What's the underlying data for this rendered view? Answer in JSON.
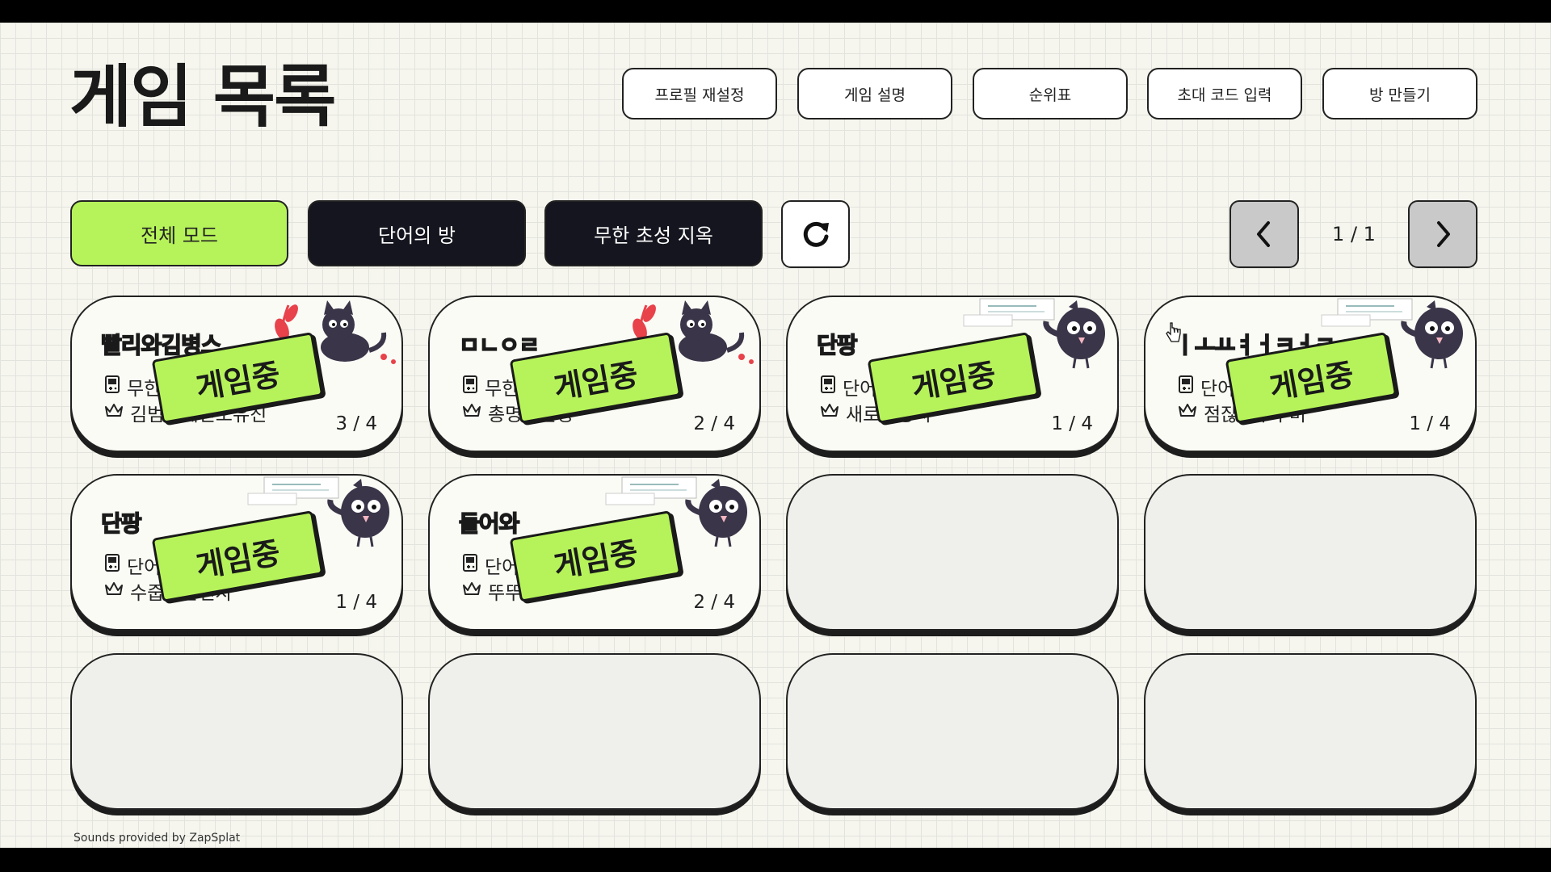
{
  "header": {
    "title": "게임 목록",
    "buttons": {
      "reset_profile": "프로필 재설정",
      "game_guide": "게임 설명",
      "leaderboard": "순위표",
      "invite_code": "초대 코드 입력",
      "create_room": "방 만들기"
    }
  },
  "filters": {
    "all_modes": "전체 모드",
    "word_room": "단어의 방",
    "infinite_chosung": "무한 초성 지옥"
  },
  "pagination": {
    "text": "1 / 1"
  },
  "badge_label": "게임중",
  "rooms": [
    {
      "title": "빨리와김병스",
      "title_color": "#e8424a",
      "mode": "무한",
      "host": "김범수헤딘오유진",
      "players": "3 / 4",
      "mascot": "cat"
    },
    {
      "title": "ㅁㄴㅇㄹ",
      "title_color": "#e8424a",
      "mode": "무한",
      "host": "총명한권정",
      "players": "2 / 4",
      "mascot": "cat"
    },
    {
      "title": "단팡",
      "title_color": "#8fb4d4",
      "mode": "단어",
      "host": "새로운송지",
      "players": "1 / 4",
      "mascot": "bird"
    },
    {
      "title": "ㅣㅗㅛㅕㅓㅋㅓㅋ",
      "title_color": "#8fb4d4",
      "mode": "단어",
      "host": "점잖은부우미",
      "players": "1 / 4",
      "mascot": "bird"
    },
    {
      "title": "단팡",
      "title_color": "#8fb4d4",
      "mode": "단어",
      "host": "수줍은준선자",
      "players": "1 / 4",
      "mascot": "bird"
    },
    {
      "title": "들어와",
      "title_color": "#8fb4d4",
      "mode": "단어",
      "host": "뚜뚜",
      "players": "2 / 4",
      "mascot": "bird"
    }
  ],
  "empty_slots": 6,
  "footer": "Sounds provided by ZapSplat",
  "colors": {
    "accent_green": "#b6f35a",
    "dark": "#15151f",
    "title_red": "#e8424a",
    "title_blue": "#8fb4d4"
  },
  "icons": {
    "mode": "gamepad-icon",
    "host": "crown-icon",
    "refresh": "refresh-icon",
    "prev": "chevron-left-icon",
    "next": "chevron-right-icon"
  }
}
